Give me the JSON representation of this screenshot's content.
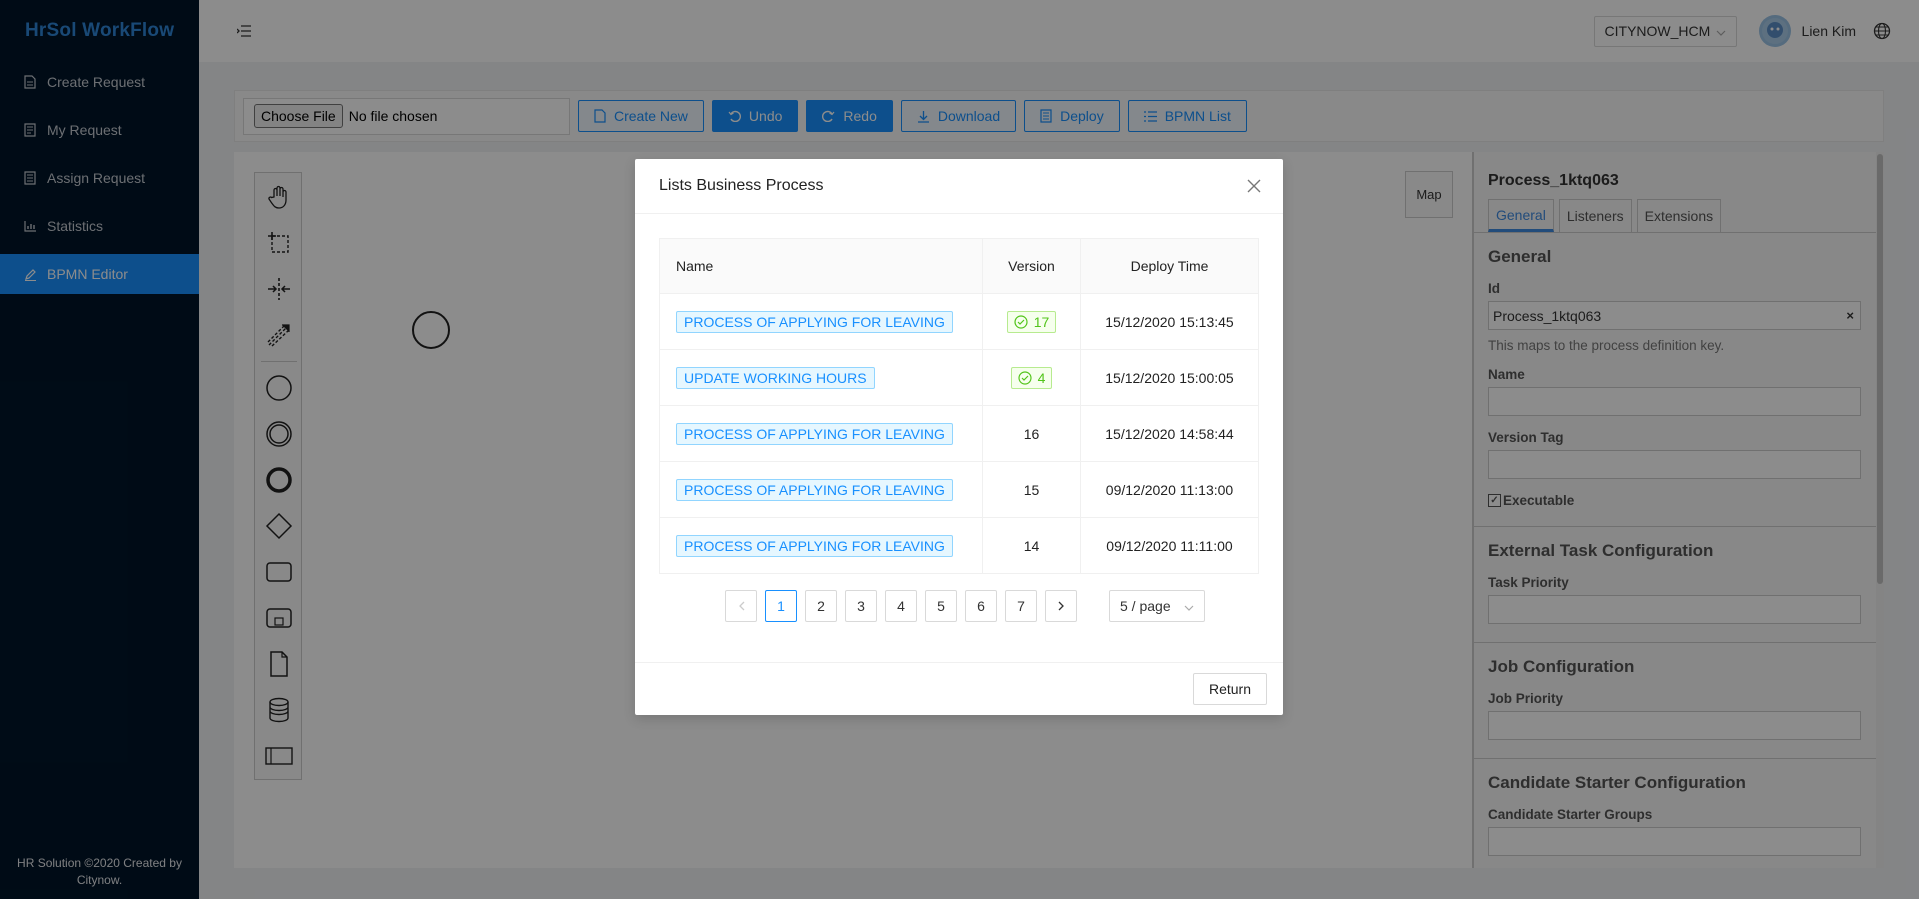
{
  "app": {
    "logo": "HrSol WorkFlow",
    "footer": "HR Solution ©2020 Created by Citynow."
  },
  "sidebar": {
    "items": [
      {
        "label": "Create Request",
        "icon": "file-icon"
      },
      {
        "label": "My Request",
        "icon": "file-icon"
      },
      {
        "label": "Assign Request",
        "icon": "file-icon"
      },
      {
        "label": "Statistics",
        "icon": "bar-chart-icon"
      },
      {
        "label": "BPMN Editor",
        "icon": "edit-icon",
        "active": true
      }
    ]
  },
  "header": {
    "tenant": "CITYNOW_HCM",
    "username": "Lien Kim"
  },
  "toolbar": {
    "choose_file": "Choose File",
    "no_file": "No file chosen",
    "create_new": "Create New",
    "undo": "Undo",
    "redo": "Redo",
    "download": "Download",
    "deploy": "Deploy",
    "bpmn_list": "BPMN List"
  },
  "canvas": {
    "map_label": "Map"
  },
  "properties": {
    "title": "Process_1ktq063",
    "tabs": [
      "General",
      "Listeners",
      "Extensions"
    ],
    "general_title": "General",
    "id_label": "Id",
    "id_value": "Process_1ktq063",
    "id_hint": "This maps to the process definition key.",
    "name_label": "Name",
    "version_tag_label": "Version Tag",
    "executable_label": "Executable",
    "external_task_title": "External Task Configuration",
    "task_priority_label": "Task Priority",
    "job_config_title": "Job Configuration",
    "job_priority_label": "Job Priority",
    "candidate_title": "Candidate Starter Configuration",
    "candidate_groups_label": "Candidate Starter Groups"
  },
  "modal": {
    "title": "Lists Business Process",
    "columns": {
      "name": "Name",
      "version": "Version",
      "deploy_time": "Deploy Time"
    },
    "rows": [
      {
        "name": "PROCESS OF APPLYING FOR LEAVING",
        "version": "17",
        "latest": true,
        "deploy_time": "15/12/2020 15:13:45"
      },
      {
        "name": "UPDATE WORKING HOURS",
        "version": "4",
        "latest": true,
        "deploy_time": "15/12/2020 15:00:05"
      },
      {
        "name": "PROCESS OF APPLYING FOR LEAVING",
        "version": "16",
        "latest": false,
        "deploy_time": "15/12/2020 14:58:44"
      },
      {
        "name": "PROCESS OF APPLYING FOR LEAVING",
        "version": "15",
        "latest": false,
        "deploy_time": "09/12/2020 11:13:00"
      },
      {
        "name": "PROCESS OF APPLYING FOR LEAVING",
        "version": "14",
        "latest": false,
        "deploy_time": "09/12/2020 11:11:00"
      }
    ],
    "pagination": {
      "pages": [
        "1",
        "2",
        "3",
        "4",
        "5",
        "6",
        "7"
      ],
      "current": "1",
      "page_size": "5 / page"
    },
    "return_label": "Return"
  },
  "colors": {
    "primary": "#1890ff",
    "sidebar_bg": "#001529",
    "success": "#52c41a"
  }
}
